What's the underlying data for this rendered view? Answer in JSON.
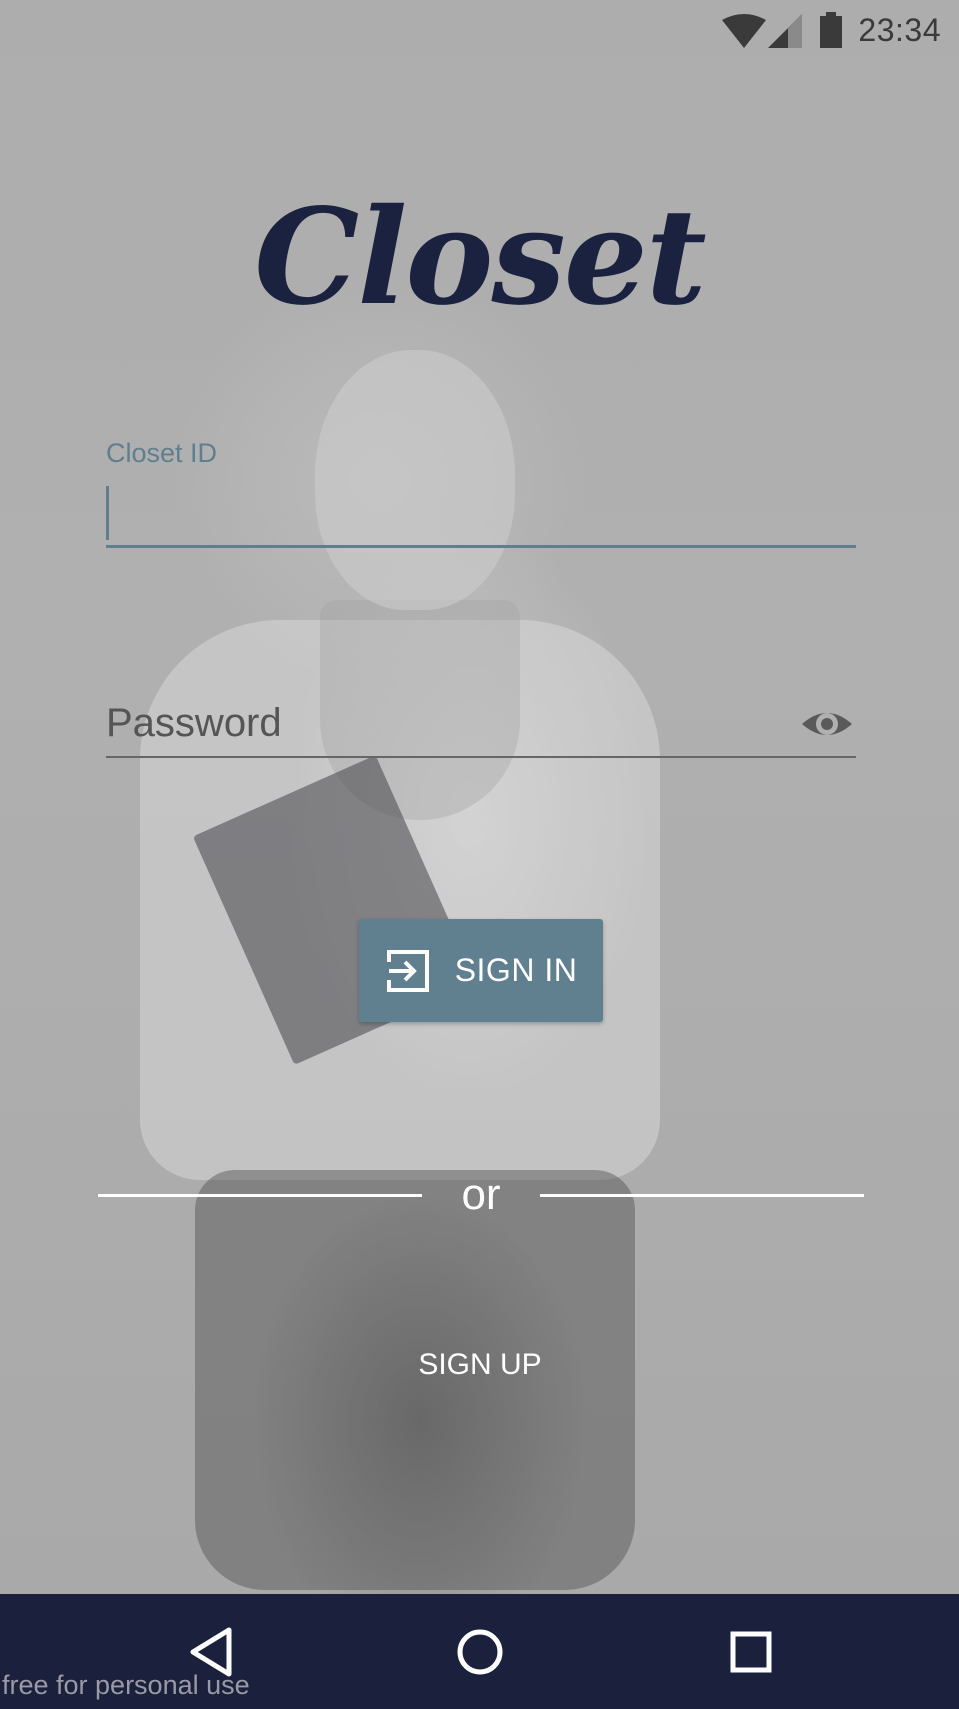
{
  "status_bar": {
    "time": "23:34",
    "icons": [
      "wifi-icon",
      "cell-signal-icon",
      "battery-icon"
    ]
  },
  "app": {
    "logo_text": "Closet",
    "logo_color": "#1b2240"
  },
  "form": {
    "id_label": "Closet ID",
    "id_value": "",
    "password_placeholder": "Password",
    "password_value": "",
    "password_toggle_icon": "eye-icon",
    "accent_color": "#5f7f8e"
  },
  "actions": {
    "signin_label": "SIGN IN",
    "signin_icon": "login-icon",
    "signin_color": "#60808f",
    "divider_text": "or",
    "signup_label": "SIGN UP"
  },
  "nav_bar": {
    "color": "#1b213c",
    "buttons": [
      "back-icon",
      "home-icon",
      "recents-icon"
    ]
  },
  "watermark": "free for personal use"
}
